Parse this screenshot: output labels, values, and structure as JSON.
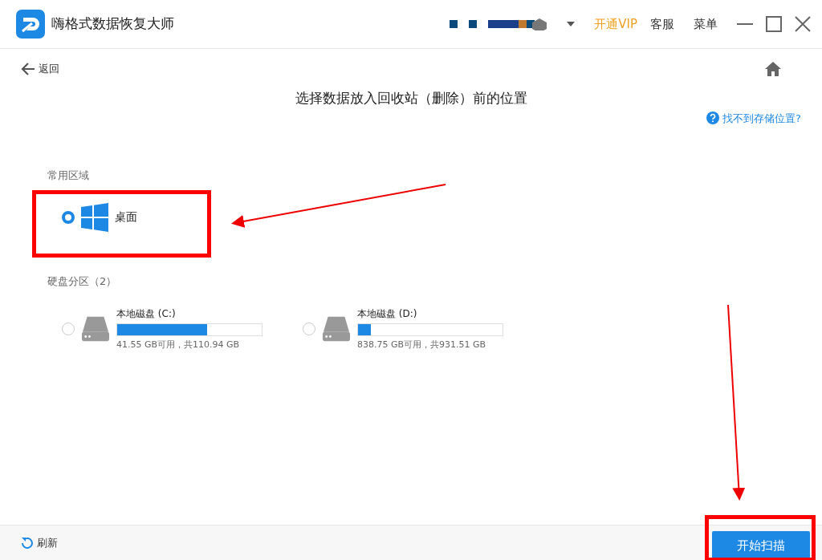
{
  "window": {
    "title": "嗨格式数据恢复大师",
    "vip": "开通VIP",
    "service": "客服",
    "menu": "菜单"
  },
  "nav": {
    "back": "返回"
  },
  "heading": "选择数据放入回收站（删除）前的位置",
  "help_link": "找不到存储位置?",
  "common": {
    "label": "常用区域",
    "items": [
      {
        "name": "桌面",
        "selected": true
      }
    ]
  },
  "disks": {
    "label": "硬盘分区（2）",
    "items": [
      {
        "name": "本地磁盘 (C:)",
        "level": 0.62,
        "usage": "41.55 GB可用，共110.94 GB",
        "selected": false
      },
      {
        "name": "本地磁盘 (D:)",
        "level": 0.09,
        "usage": "838.75 GB可用，共931.51 GB",
        "selected": false
      }
    ]
  },
  "footer": {
    "refresh": "刷新",
    "start": "开始扫描"
  }
}
